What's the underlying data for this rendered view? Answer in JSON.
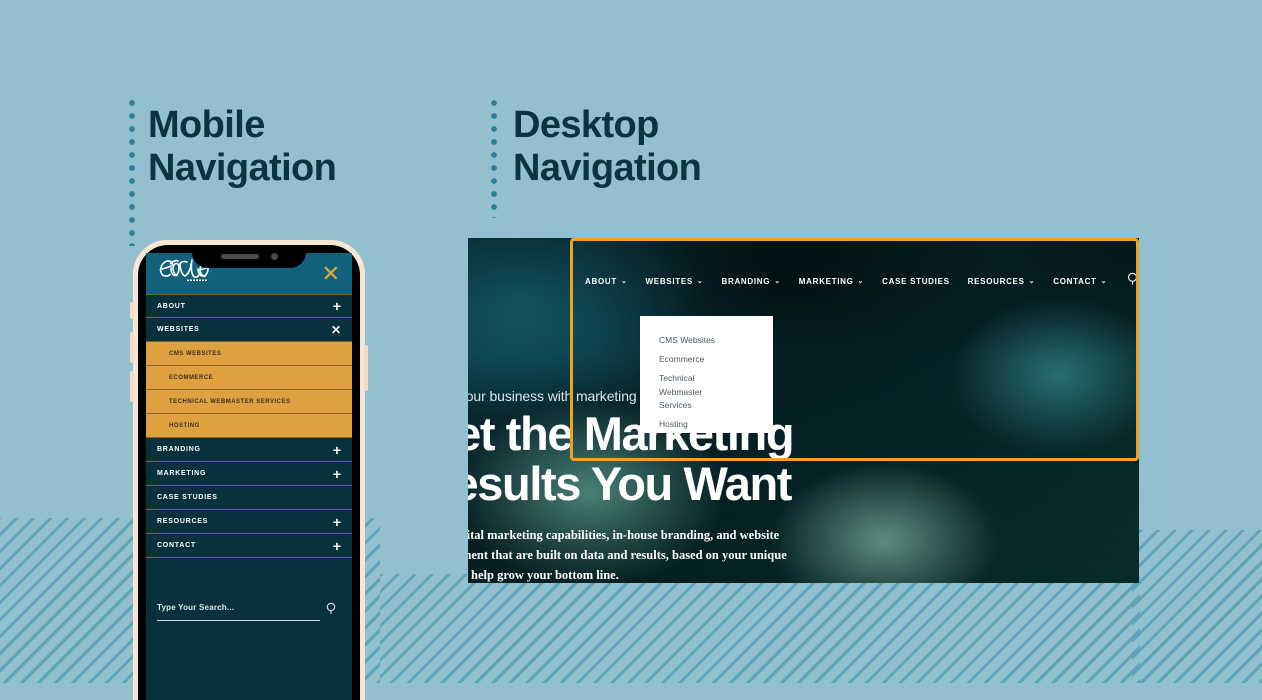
{
  "theme": {
    "bg": "#92c0ce",
    "stripe": "#5ea5bb",
    "heading": "#0b3440",
    "dot": "#2a7f96",
    "menu_dark": "#07323d",
    "menu_header": "#11627a",
    "submenu_orange": "#dfa040",
    "close_orange": "#e8a838",
    "highlight_orange": "#f0a41e",
    "white": "#ffffff"
  },
  "sections": {
    "mobile": {
      "title": "Mobile\nNavigation"
    },
    "desktop": {
      "title": "Desktop\nNavigation"
    }
  },
  "phone": {
    "logo_text": "Evolve",
    "logo_sub": "SYSTEMS",
    "close_icon": "close-icon",
    "close_glyph": "✕",
    "nav": [
      {
        "label": "ABOUT",
        "toggle": "+",
        "expanded": false
      },
      {
        "label": "WEBSITES",
        "toggle": "✕",
        "expanded": true
      },
      {
        "label": "BRANDING",
        "toggle": "+",
        "expanded": false
      },
      {
        "label": "MARKETING",
        "toggle": "+",
        "expanded": false
      },
      {
        "label": "CASE STUDIES",
        "toggle": "",
        "expanded": false
      },
      {
        "label": "RESOURCES",
        "toggle": "+",
        "expanded": false
      },
      {
        "label": "CONTACT",
        "toggle": "+",
        "expanded": false
      }
    ],
    "submenu": [
      {
        "label": "CMS WEBSITES"
      },
      {
        "label": "ECOMMERCE"
      },
      {
        "label": "TECHNICAL WEBMASTER SERVICES"
      },
      {
        "label": "HOSTING"
      }
    ],
    "search": {
      "placeholder": "Type Your Search...",
      "value": "",
      "icon": "search-icon"
    }
  },
  "desktop": {
    "nav": [
      {
        "label": "ABOUT",
        "caret": "⌄",
        "has_caret": true
      },
      {
        "label": "WEBSITES",
        "caret": "⌄",
        "has_caret": true
      },
      {
        "label": "BRANDING",
        "caret": "⌄",
        "has_caret": true
      },
      {
        "label": "MARKETING",
        "caret": "⌄",
        "has_caret": true
      },
      {
        "label": "CASE STUDIES",
        "caret": "",
        "has_caret": false
      },
      {
        "label": "RESOURCES",
        "caret": "⌄",
        "has_caret": true
      },
      {
        "label": "CONTACT",
        "caret": "⌄",
        "has_caret": true
      }
    ],
    "search_icon": "search-icon",
    "dropdown": {
      "parent": "WEBSITES",
      "items": [
        {
          "label": "CMS Websites"
        },
        {
          "label": "Ecommerce"
        },
        {
          "label": "Technical Webmaster Services"
        },
        {
          "label": "Hosting"
        }
      ]
    },
    "hero": {
      "eyebrow": "Grow your business with marketing",
      "headline": "Get the Marketing\nResults You Want",
      "body": "With digital marketing capabilities, in-house branding, and website\ndevelopment that are built on data and results, based on your unique\ngoals, we help grow your bottom line."
    }
  }
}
